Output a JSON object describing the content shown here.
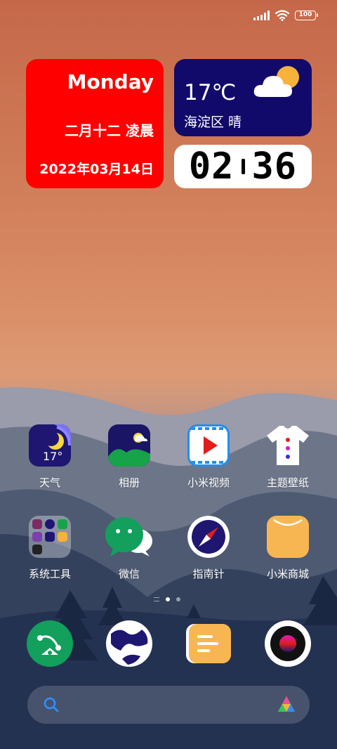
{
  "status_bar": {
    "battery": "100",
    "icons": [
      "signal-icon",
      "wifi-icon",
      "battery-icon"
    ]
  },
  "widgets": {
    "date": {
      "day": "Monday",
      "lunar": "二月十二 凌晨",
      "full_date": "2022年03月14日",
      "bg": "#ff0000"
    },
    "weather": {
      "temp": "17℃",
      "location": "海淀区 晴",
      "bg": "#120a6b"
    },
    "clock": {
      "hours": "02",
      "minutes": "36"
    }
  },
  "apps": [
    {
      "label": "天气",
      "icon": "weather-icon",
      "badge": "17°"
    },
    {
      "label": "相册",
      "icon": "gallery-icon"
    },
    {
      "label": "小米视频",
      "icon": "video-icon"
    },
    {
      "label": "主题壁纸",
      "icon": "theme-icon"
    },
    {
      "label": "系统工具",
      "icon": "folder-icon"
    },
    {
      "label": "微信",
      "icon": "wechat-icon"
    },
    {
      "label": "指南针",
      "icon": "compass-icon"
    },
    {
      "label": "小米商城",
      "icon": "mi-store-icon"
    }
  ],
  "dock": [
    {
      "icon": "phone-icon"
    },
    {
      "icon": "browser-icon"
    },
    {
      "icon": "notes-icon"
    },
    {
      "icon": "camera-icon"
    }
  ],
  "page_indicator": {
    "pages": 2,
    "active": 1
  },
  "search": {
    "icon": "search-icon",
    "assistant_icon": "app-vault-icon"
  }
}
